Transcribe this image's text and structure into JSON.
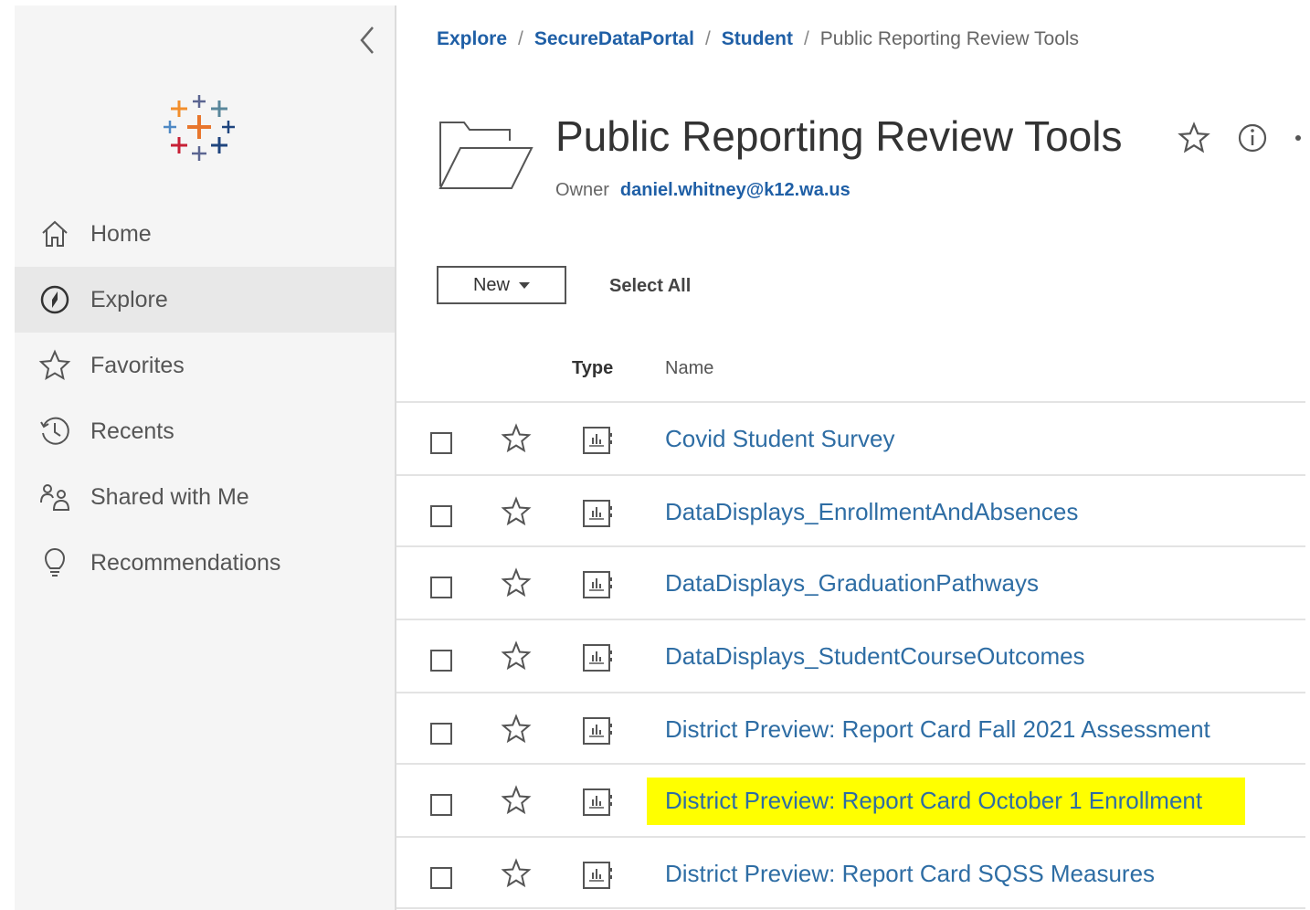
{
  "sidebar": {
    "items": [
      {
        "label": "Home",
        "icon": "home-icon",
        "active": false
      },
      {
        "label": "Explore",
        "icon": "compass-icon",
        "active": true
      },
      {
        "label": "Favorites",
        "icon": "star-icon",
        "active": false
      },
      {
        "label": "Recents",
        "icon": "clock-icon",
        "active": false
      },
      {
        "label": "Shared with Me",
        "icon": "shared-users-icon",
        "active": false
      },
      {
        "label": "Recommendations",
        "icon": "lightbulb-icon",
        "active": false
      }
    ]
  },
  "breadcrumb": {
    "items": [
      "Explore",
      "SecureDataPortal",
      "Student"
    ],
    "current": "Public Reporting Review Tools",
    "separator": "/"
  },
  "project": {
    "title": "Public Reporting Review Tools",
    "owner_label": "Owner",
    "owner_email": "daniel.whitney@k12.wa.us"
  },
  "toolbar": {
    "new_label": "New",
    "select_all_label": "Select All"
  },
  "table": {
    "columns": {
      "type": "Type",
      "name": "Name"
    },
    "rows": [
      {
        "name": "Covid Student Survey",
        "highlighted": false
      },
      {
        "name": "DataDisplays_EnrollmentAndAbsences",
        "highlighted": false
      },
      {
        "name": "DataDisplays_GraduationPathways",
        "highlighted": false
      },
      {
        "name": "DataDisplays_StudentCourseOutcomes",
        "highlighted": false
      },
      {
        "name": "District Preview: Report Card Fall 2021 Assessment",
        "highlighted": false
      },
      {
        "name": "District Preview: Report Card October 1 Enrollment",
        "highlighted": true
      },
      {
        "name": "District Preview: Report Card SQSS Measures",
        "highlighted": false
      }
    ]
  },
  "colors": {
    "link": "#1f5fa6",
    "row_link": "#2e6da4",
    "highlight": "#ffff00",
    "sidebar_bg": "#f5f5f5",
    "active_bg": "#e8e8e8"
  }
}
